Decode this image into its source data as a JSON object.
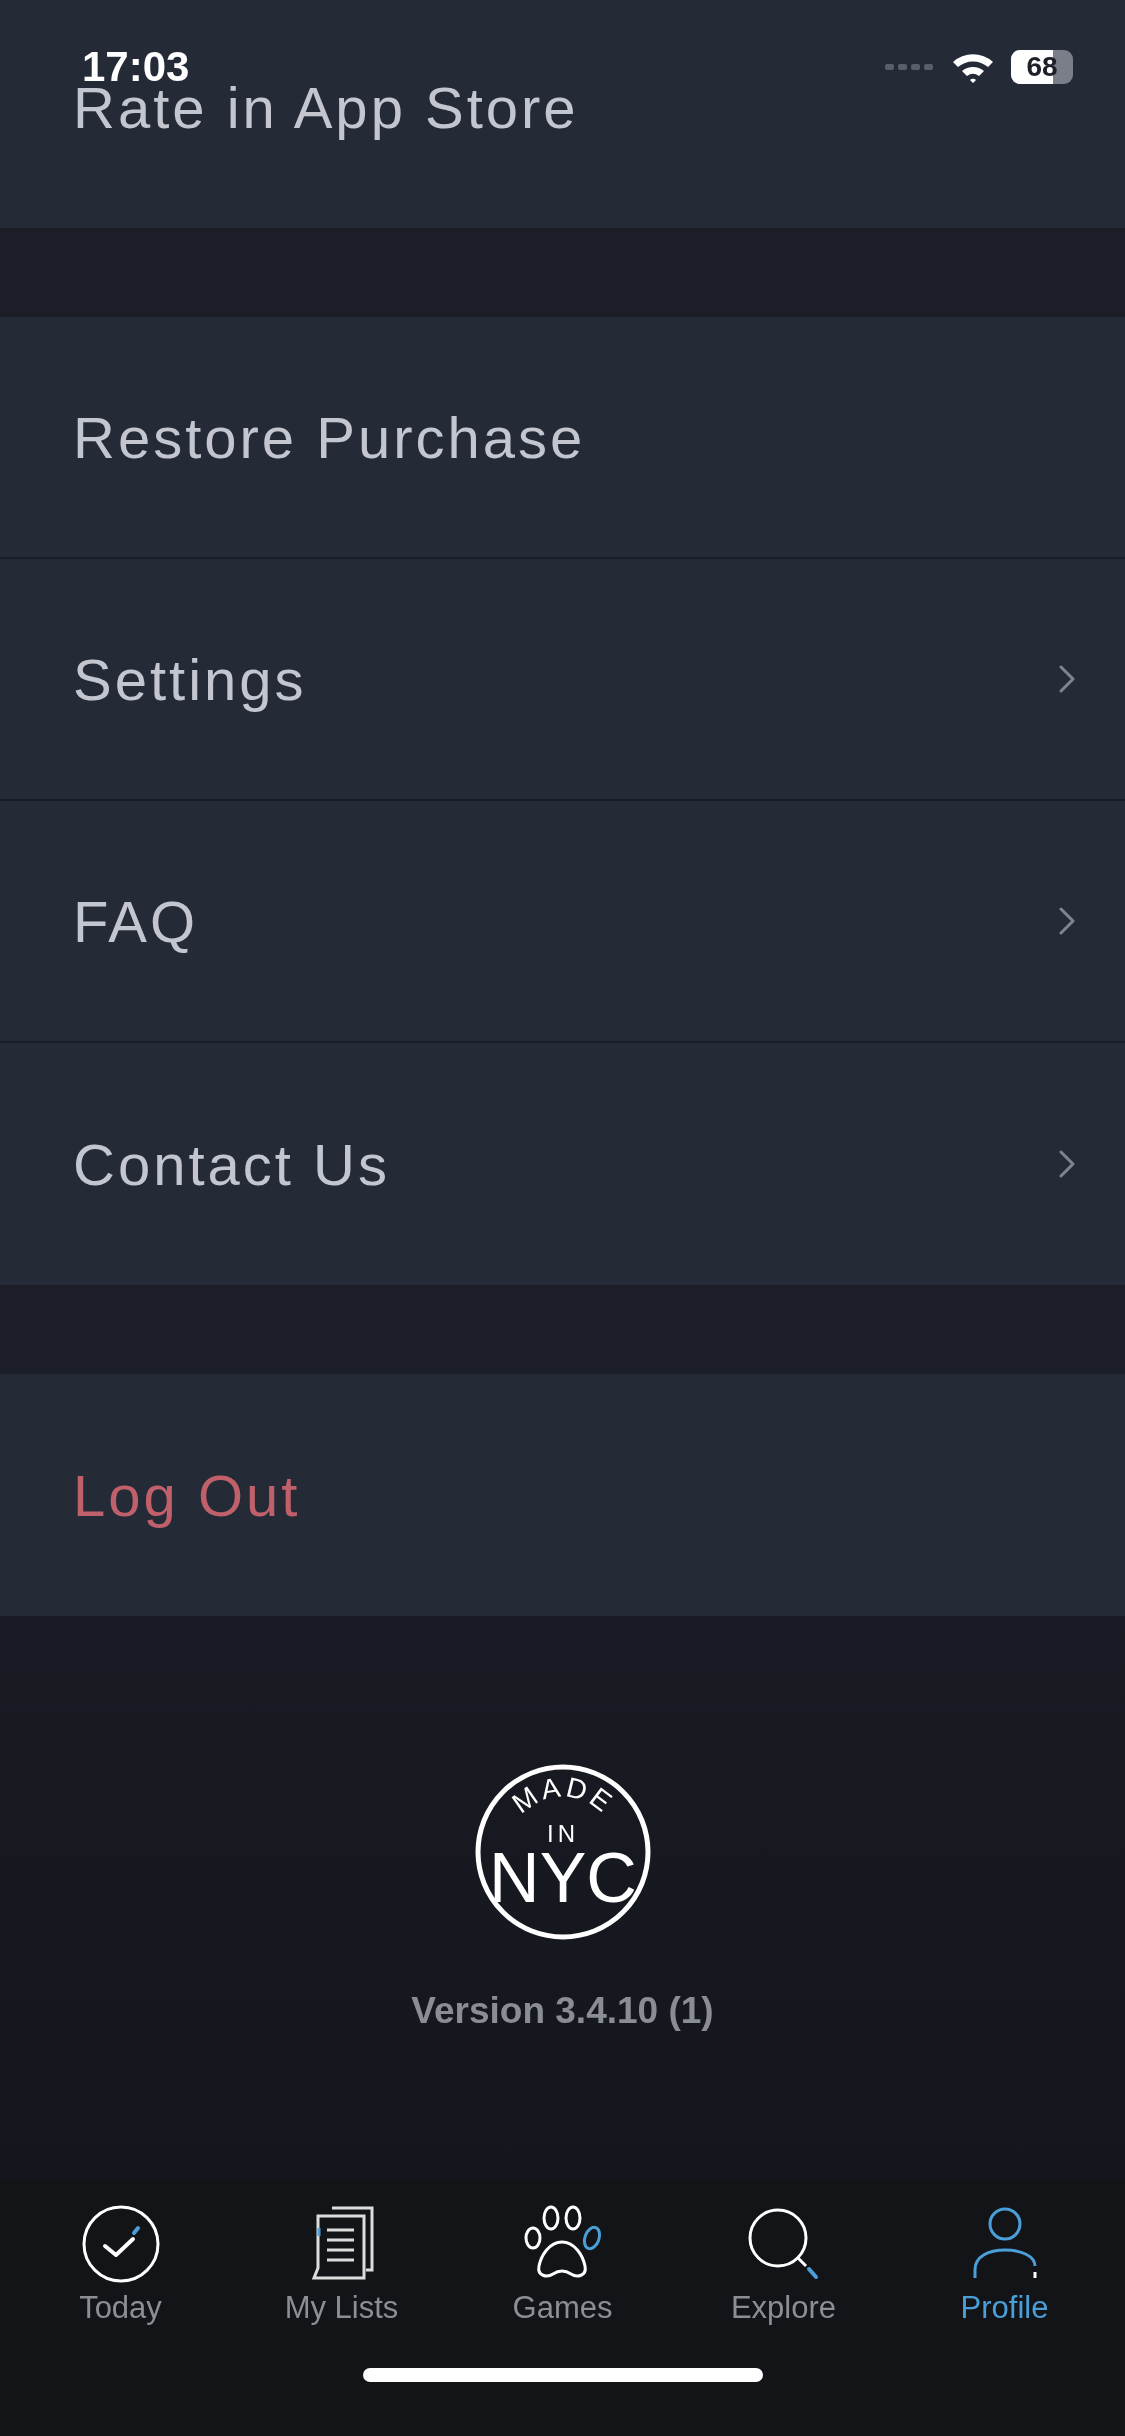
{
  "status_bar": {
    "time": "17:03",
    "battery": "68"
  },
  "groups": [
    {
      "rows": [
        {
          "label": "Rate in App Store",
          "kind": "plain"
        }
      ]
    },
    {
      "rows": [
        {
          "label": "Restore Purchase",
          "kind": "plain"
        },
        {
          "label": "Settings",
          "kind": "nav"
        },
        {
          "label": "FAQ",
          "kind": "nav"
        },
        {
          "label": "Contact Us",
          "kind": "nav"
        }
      ]
    },
    {
      "rows": [
        {
          "label": "Log Out",
          "kind": "destructive"
        }
      ]
    }
  ],
  "footer": {
    "logo": {
      "top": "MADE",
      "middle": "IN",
      "bottom": "NYC"
    },
    "version": "Version 3.4.10 (1)"
  },
  "tabs": [
    {
      "label": "Today",
      "selected": false
    },
    {
      "label": "My Lists",
      "selected": false
    },
    {
      "label": "Games",
      "selected": false
    },
    {
      "label": "Explore",
      "selected": false
    },
    {
      "label": "Profile",
      "selected": true
    }
  ]
}
